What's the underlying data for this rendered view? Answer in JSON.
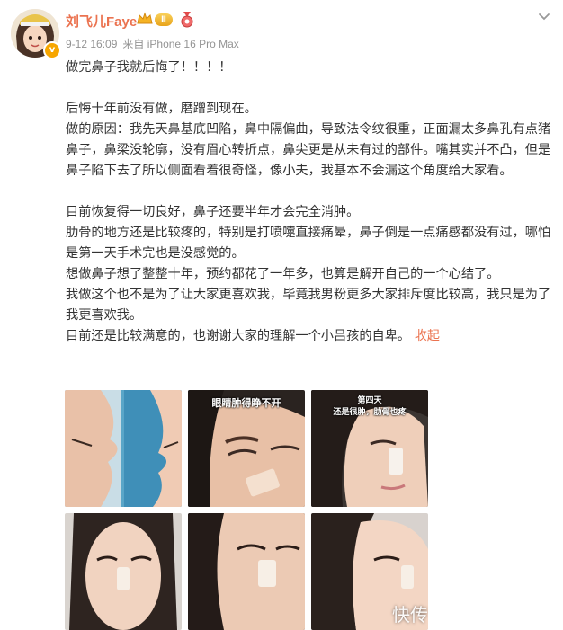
{
  "post": {
    "author": {
      "name": "刘飞儿Faye",
      "level": "Ⅱ",
      "verified_mark": "v"
    },
    "time": "9-12 16:09",
    "source": "来自 iPhone 16 Pro Max",
    "paragraphs": [
      "做完鼻子我就后悔了！！！！",
      "",
      "后悔十年前没有做，磨蹭到现在。",
      "做的原因：我先天鼻基底凹陷，鼻中隔偏曲，导致法令纹很重，正面漏太多鼻孔有点猪鼻子，鼻梁没轮廓，没有眉心转折点，鼻尖更是从未有过的部件。嘴其实并不凸，但是鼻子陷下去了所以侧面看着很奇怪，像小夫，我基本不会漏这个角度给大家看。",
      "",
      "目前恢复得一切良好，鼻子还要半年才会完全消肿。",
      "肋骨的地方还是比较疼的，特别是打喷嚏直接痛晕，鼻子倒是一点痛感都没有过，哪怕是第一天手术完也是没感觉的。",
      "想做鼻子想了整整十年，预约都花了一年多，也算是解开自己的一个心结了。",
      "我做这个也不是为了让大家更喜欢我，毕竟我男粉更多大家排斥度比较高，我只是为了我更喜欢我。"
    ],
    "last_line": "目前还是比较满意的，也谢谢大家的理解一个小吕孩的自卑。",
    "collapse_label": "收起",
    "images": [
      {
        "name": "side-profile-photo",
        "caption": ""
      },
      {
        "name": "swollen-eyes-photo",
        "caption": "眼睛肿得睁不开"
      },
      {
        "name": "day-four-photo",
        "caption_line1": "第四天",
        "caption_line2": "还是很肿，肋骨也疼"
      },
      {
        "name": "selfie-front-photo",
        "caption": ""
      },
      {
        "name": "closeup-bandage-photo",
        "caption": ""
      },
      {
        "name": "side-selfie-photo",
        "caption": ""
      }
    ],
    "watermark": "快传"
  },
  "colors": {
    "accent": "#eb7350",
    "meta": "#939393",
    "text": "#333333"
  },
  "icons": [
    "verified-badge-icon",
    "crown-icon",
    "level-badge-icon",
    "medal-icon",
    "chevron-down-icon"
  ]
}
